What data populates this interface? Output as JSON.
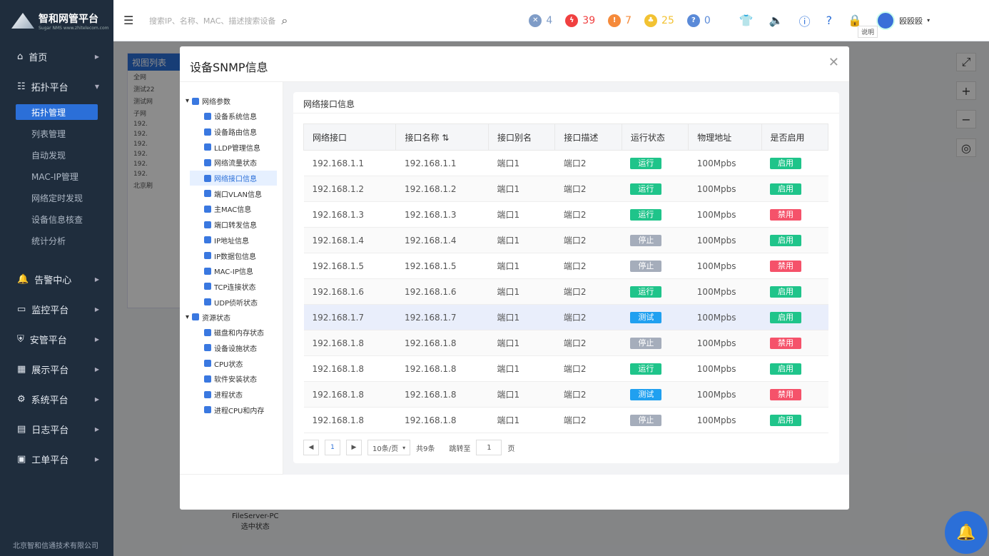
{
  "app": {
    "brand": "智和网管平台",
    "brand_sub": "Sugar NMS  www.zhitelecom.com",
    "company": "北京智和信通技术有限公司"
  },
  "nav": [
    {
      "label": "首页",
      "icon": "home-icon"
    },
    {
      "label": "拓扑平台",
      "icon": "topology-icon",
      "expanded": true
    },
    {
      "label": "告警中心",
      "icon": "bell-icon"
    },
    {
      "label": "监控平台",
      "icon": "monitor-icon"
    },
    {
      "label": "安管平台",
      "icon": "shield-icon"
    },
    {
      "label": "展示平台",
      "icon": "grid-icon"
    },
    {
      "label": "系统平台",
      "icon": "gear-icon"
    },
    {
      "label": "日志平台",
      "icon": "log-icon"
    },
    {
      "label": "工单平台",
      "icon": "clipboard-icon"
    }
  ],
  "subnav": [
    "拓扑管理",
    "列表管理",
    "自动发现",
    "MAC-IP管理",
    "网络定时发现",
    "设备信息核查",
    "统计分析"
  ],
  "topbar": {
    "search_placeholder": "搜索IP、名称、MAC、描述搜索设备",
    "stats": [
      {
        "value": "4",
        "color": "#7f9cc7",
        "icon": "x-icon"
      },
      {
        "value": "39",
        "color": "#f04040",
        "icon": "lightning-icon"
      },
      {
        "value": "7",
        "color": "#f58a3a",
        "icon": "exclaim-icon"
      },
      {
        "value": "25",
        "color": "#f2c232",
        "icon": "bell-icon"
      },
      {
        "value": "0",
        "color": "#5a8ad8",
        "icon": "question-icon"
      }
    ],
    "help_tooltip": "说明",
    "user": "殴殴殴"
  },
  "bg": {
    "panel_title": "视图列表",
    "items": [
      "全网",
      "测试22",
      "测试网",
      "子网",
      "192.",
      "192.",
      "192.",
      "192.",
      "192.",
      "192.",
      "北京刷"
    ],
    "fileserver": "FileServer-PC",
    "fileserver_state": "选中状态"
  },
  "modal": {
    "title": "设备SNMP信息",
    "tree": {
      "group1": "网络参数",
      "group1_items": [
        "设备系统信息",
        "设备路由信息",
        "LLDP管理信息",
        "网络流量状态",
        "网络接口信息",
        "端口VLAN信息",
        "主MAC信息",
        "端口转发信息",
        "IP地址信息",
        "IP数据包信息",
        "MAC-IP信息",
        "TCP连接状态",
        "UDP侦听状态"
      ],
      "group2": "资源状态",
      "group2_items": [
        "磁盘和内存状态",
        "设备设施状态",
        "CPU状态",
        "软件安装状态",
        "进程状态",
        "进程CPU和内存"
      ],
      "active_index": 4
    },
    "card_title": "网络接口信息",
    "columns": [
      "网络接口",
      "接口名称",
      "接口别名",
      "接口描述",
      "运行状态",
      "物理地址",
      "是否启用"
    ],
    "rows": [
      {
        "iface": "192.168.1.1",
        "name": "192.168.1.1",
        "alias": "端口1",
        "desc": "端口2",
        "status": "运行",
        "mac": "100Mpbs",
        "enabled": "启用"
      },
      {
        "iface": "192.168.1.2",
        "name": "192.168.1.2",
        "alias": "端口1",
        "desc": "端口2",
        "status": "运行",
        "mac": "100Mpbs",
        "enabled": "启用"
      },
      {
        "iface": "192.168.1.3",
        "name": "192.168.1.3",
        "alias": "端口1",
        "desc": "端口2",
        "status": "运行",
        "mac": "100Mpbs",
        "enabled": "禁用"
      },
      {
        "iface": "192.168.1.4",
        "name": "192.168.1.4",
        "alias": "端口1",
        "desc": "端口2",
        "status": "停止",
        "mac": "100Mpbs",
        "enabled": "启用"
      },
      {
        "iface": "192.168.1.5",
        "name": "192.168.1.5",
        "alias": "端口1",
        "desc": "端口2",
        "status": "停止",
        "mac": "100Mpbs",
        "enabled": "禁用"
      },
      {
        "iface": "192.168.1.6",
        "name": "192.168.1.6",
        "alias": "端口1",
        "desc": "端口2",
        "status": "运行",
        "mac": "100Mpbs",
        "enabled": "启用"
      },
      {
        "iface": "192.168.1.7",
        "name": "192.168.1.7",
        "alias": "端口1",
        "desc": "端口2",
        "status": "测试",
        "mac": "100Mpbs",
        "enabled": "启用"
      },
      {
        "iface": "192.168.1.8",
        "name": "192.168.1.8",
        "alias": "端口1",
        "desc": "端口2",
        "status": "停止",
        "mac": "100Mpbs",
        "enabled": "禁用"
      },
      {
        "iface": "192.168.1.8",
        "name": "192.168.1.8",
        "alias": "端口1",
        "desc": "端口2",
        "status": "运行",
        "mac": "100Mpbs",
        "enabled": "启用"
      },
      {
        "iface": "192.168.1.8",
        "name": "192.168.1.8",
        "alias": "端口1",
        "desc": "端口2",
        "status": "测试",
        "mac": "100Mpbs",
        "enabled": "禁用"
      },
      {
        "iface": "192.168.1.8",
        "name": "192.168.1.8",
        "alias": "端口1",
        "desc": "端口2",
        "status": "停止",
        "mac": "100Mpbs",
        "enabled": "启用"
      }
    ],
    "pager": {
      "page": "1",
      "page_size": "10条/页",
      "total": "共9条",
      "goto_label": "跳转至",
      "goto_value": "1",
      "page_unit": "页"
    }
  }
}
